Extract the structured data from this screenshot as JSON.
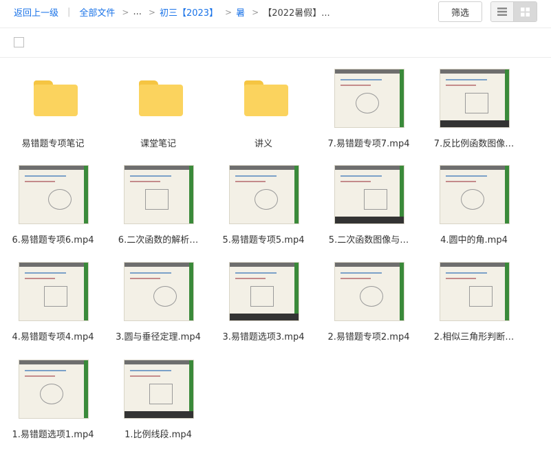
{
  "toolbar": {
    "back_label": "返回上一级",
    "all_files_label": "全部文件",
    "ellipsis": "...",
    "crumb1": "初三【2023】",
    "crumb2": "暑",
    "crumb3": "【2022暑假】...",
    "filter_label": "筛选",
    "list_view_icon": "list-icon",
    "grid_view_icon": "grid-icon"
  },
  "colors": {
    "link": "#1a73e8",
    "folder": "#fbd35e",
    "active_toggle": "#d9d9d9"
  },
  "files": [
    {
      "type": "folder",
      "name": "易错题专项笔记"
    },
    {
      "type": "folder",
      "name": "课堂笔记"
    },
    {
      "type": "folder",
      "name": "讲义"
    },
    {
      "type": "video",
      "name": "7.易错题专项7.mp4"
    },
    {
      "type": "video",
      "name": "7.反比例函数图像…"
    },
    {
      "type": "video",
      "name": "6.易错题专项6.mp4"
    },
    {
      "type": "video",
      "name": "6.二次函数的解析…"
    },
    {
      "type": "video",
      "name": "5.易错题专项5.mp4"
    },
    {
      "type": "video",
      "name": "5.二次函数图像与…"
    },
    {
      "type": "video",
      "name": "4.圆中的角.mp4"
    },
    {
      "type": "video",
      "name": "4.易错题专项4.mp4"
    },
    {
      "type": "video",
      "name": "3.圆与垂径定理.mp4"
    },
    {
      "type": "video",
      "name": "3.易错题选项3.mp4"
    },
    {
      "type": "video",
      "name": "2.易错题专项2.mp4"
    },
    {
      "type": "video",
      "name": "2.相似三角形判断…"
    },
    {
      "type": "video",
      "name": "1.易错题选项1.mp4"
    },
    {
      "type": "video",
      "name": "1.比例线段.mp4"
    }
  ]
}
